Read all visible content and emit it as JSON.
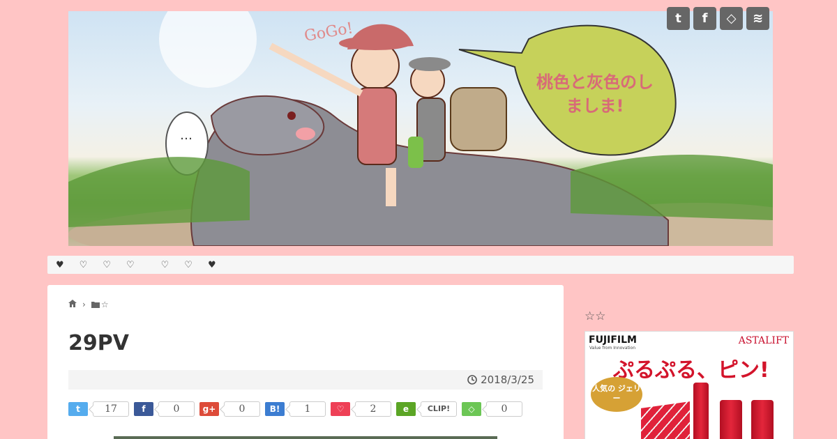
{
  "header": {
    "banner_title": "桃色と灰色のしましま!",
    "speech_gogo": "GoGo!",
    "speech_dots": "…",
    "social_icons": [
      "twitter-icon",
      "facebook-icon",
      "feedly-icon",
      "rss-icon"
    ],
    "social_glyphs": [
      "t",
      "f",
      "◇",
      "≋"
    ]
  },
  "nav": {
    "items": [
      "♥",
      "♡",
      "♡",
      "♡",
      "♡",
      "♡",
      "♥"
    ]
  },
  "breadcrumb": {
    "home_icon": "home-icon",
    "sep": "›",
    "category": "☆"
  },
  "post": {
    "title": "29PV",
    "date": "2018/3/25"
  },
  "shares": [
    {
      "name": "twitter",
      "glyph": "t",
      "count": "17",
      "color": "#55acee"
    },
    {
      "name": "facebook",
      "glyph": "f",
      "count": "0",
      "color": "#3b5998"
    },
    {
      "name": "googleplus",
      "glyph": "g+",
      "count": "0",
      "color": "#dd4b39"
    },
    {
      "name": "hatena",
      "glyph": "B!",
      "count": "1",
      "color": "#3c7dd1"
    },
    {
      "name": "pocket",
      "glyph": "♡",
      "count": "2",
      "color": "#ee4056"
    },
    {
      "name": "evernote",
      "glyph": "e",
      "count": "CLIP!",
      "color": "#5ba525"
    },
    {
      "name": "feedly",
      "glyph": "◇",
      "count": "0",
      "color": "#6cc655"
    }
  ],
  "sidebar": {
    "title": "☆☆",
    "ad": {
      "brand": "FUJIFILM",
      "brand_sub": "Value from Innovation",
      "product_line": "ASTALIFT",
      "headline": "ぷるぷる、ピン!",
      "badge": "人気の ジェリー"
    }
  },
  "colors": {
    "page_bg": "#ffc5c5",
    "accent": "#d3142b"
  }
}
